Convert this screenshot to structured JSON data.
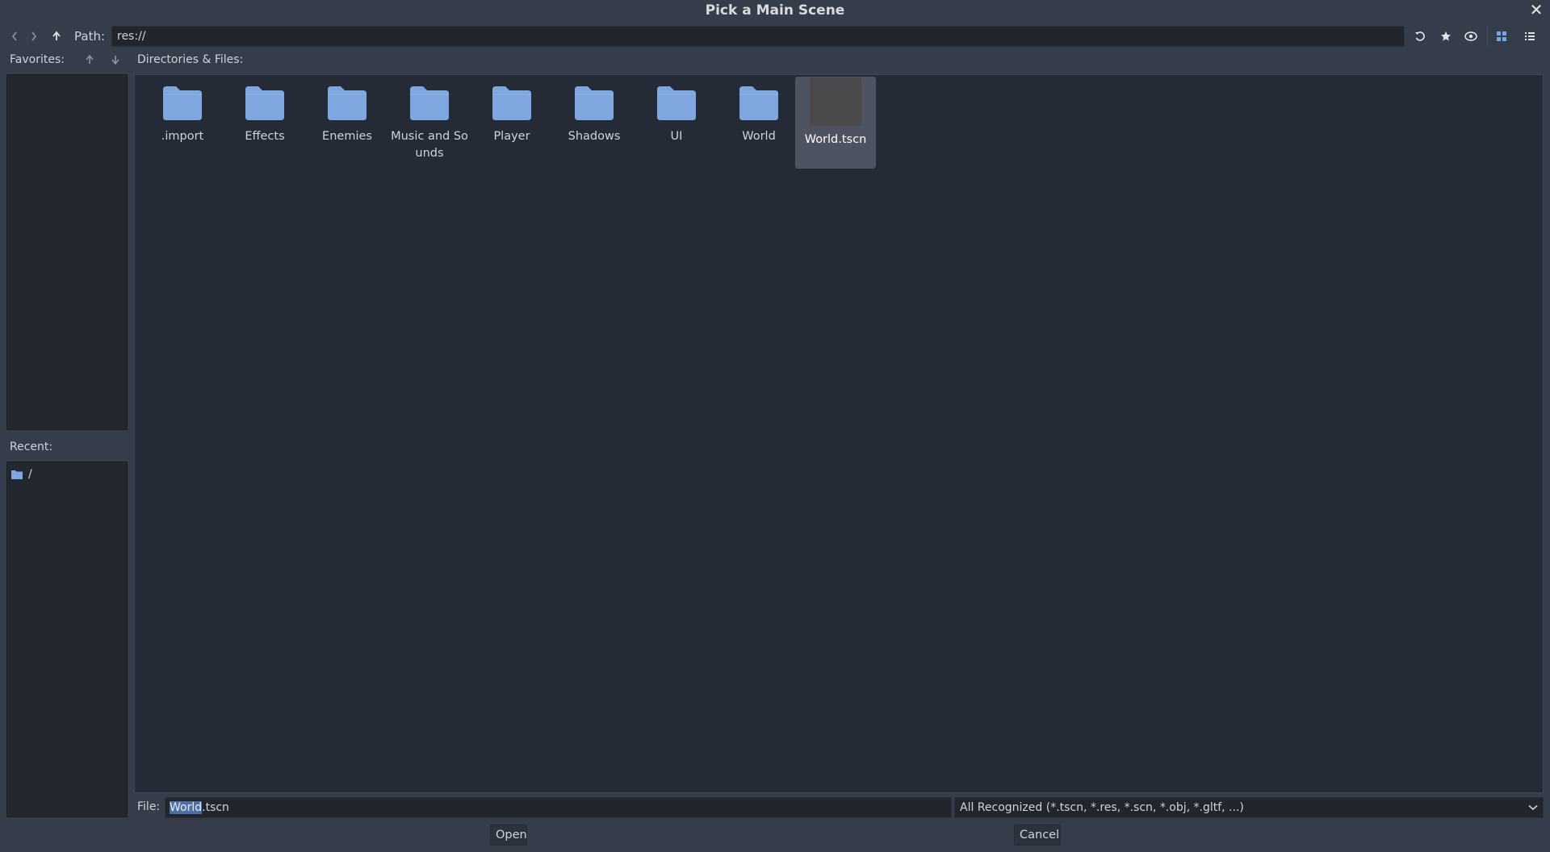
{
  "dialog": {
    "title": "Pick a Main Scene",
    "close_glyph": "✕"
  },
  "toolbar": {
    "path_label": "Path:",
    "path_value": "res://",
    "icons": [
      "back-icon",
      "forward-icon",
      "go-up-icon",
      "refresh-icon",
      "favorite-star-icon",
      "toggle-hidden-eye-icon",
      "grid-view-icon",
      "list-view-icon"
    ]
  },
  "favorites": {
    "label": "Favorites:",
    "items": []
  },
  "recent": {
    "label": "Recent:",
    "items": [
      {
        "label": "/",
        "icon": "folder-icon"
      }
    ]
  },
  "files": {
    "label": "Directories & Files:",
    "items": [
      {
        "name": ".import",
        "type": "folder",
        "selected": false
      },
      {
        "name": "Effects",
        "type": "folder",
        "selected": false
      },
      {
        "name": "Enemies",
        "type": "folder",
        "selected": false
      },
      {
        "name": "Music and Sounds",
        "type": "folder",
        "selected": false
      },
      {
        "name": "Player",
        "type": "folder",
        "selected": false
      },
      {
        "name": "Shadows",
        "type": "folder",
        "selected": false
      },
      {
        "name": "UI",
        "type": "folder",
        "selected": false
      },
      {
        "name": "World",
        "type": "folder",
        "selected": false
      },
      {
        "name": "World.tscn",
        "type": "scene",
        "selected": true
      }
    ]
  },
  "file_row": {
    "label": "File:",
    "value_selected": "World",
    "value_rest": ".tscn",
    "filter": "All Recognized (*.tscn, *.res, *.scn, *.obj, *.gltf, ...)"
  },
  "buttons": {
    "open": "Open",
    "cancel": "Cancel"
  },
  "colors": {
    "background": "#363d4a",
    "panel": "#222730",
    "folder": "#7ea6df",
    "selection": "#4d5361",
    "accent": "#6fa4ee"
  }
}
